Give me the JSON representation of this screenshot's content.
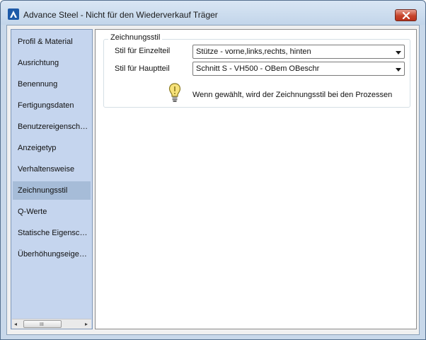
{
  "window": {
    "title": "Advance Steel - Nicht für den Wiederverkauf  Träger",
    "colors": {
      "titlebar": "#c8d8ea",
      "close_button": "#c7452c",
      "sidebar": "#c5d5ee",
      "sidebar_active": "#a6bcd8"
    }
  },
  "icons": {
    "app": "advance-steel-logo-icon",
    "close": "close-icon",
    "hint": "lightbulb-icon",
    "dropdown": "chevron-down-icon"
  },
  "sidebar": {
    "items": [
      {
        "label": "Profil & Material"
      },
      {
        "label": "Ausrichtung"
      },
      {
        "label": "Benennung"
      },
      {
        "label": "Fertigungsdaten"
      },
      {
        "label": "Benutzereigenschaften"
      },
      {
        "label": "Anzeigetyp"
      },
      {
        "label": "Verhaltensweise"
      },
      {
        "label": "Zeichnungsstil",
        "selected": true
      },
      {
        "label": "Q-Werte"
      },
      {
        "label": "Statische Eigenschaften"
      },
      {
        "label": "Überhöhungseigenschaften"
      }
    ],
    "scrollbar": {
      "left_arrow": "◂",
      "right_arrow": "▸",
      "grip": "III"
    }
  },
  "content": {
    "group_title": "Zeichnungsstil",
    "fields": [
      {
        "label": "Stil für Einzelteil",
        "value": "Stütze - vorne,links,rechts, hinten"
      },
      {
        "label": "Stil für Hauptteil",
        "value": "Schnitt S - VH500 - OBem OBeschr"
      }
    ],
    "hint": "Wenn gewählt, wird der Zeichnungsstil bei den Prozessen"
  }
}
